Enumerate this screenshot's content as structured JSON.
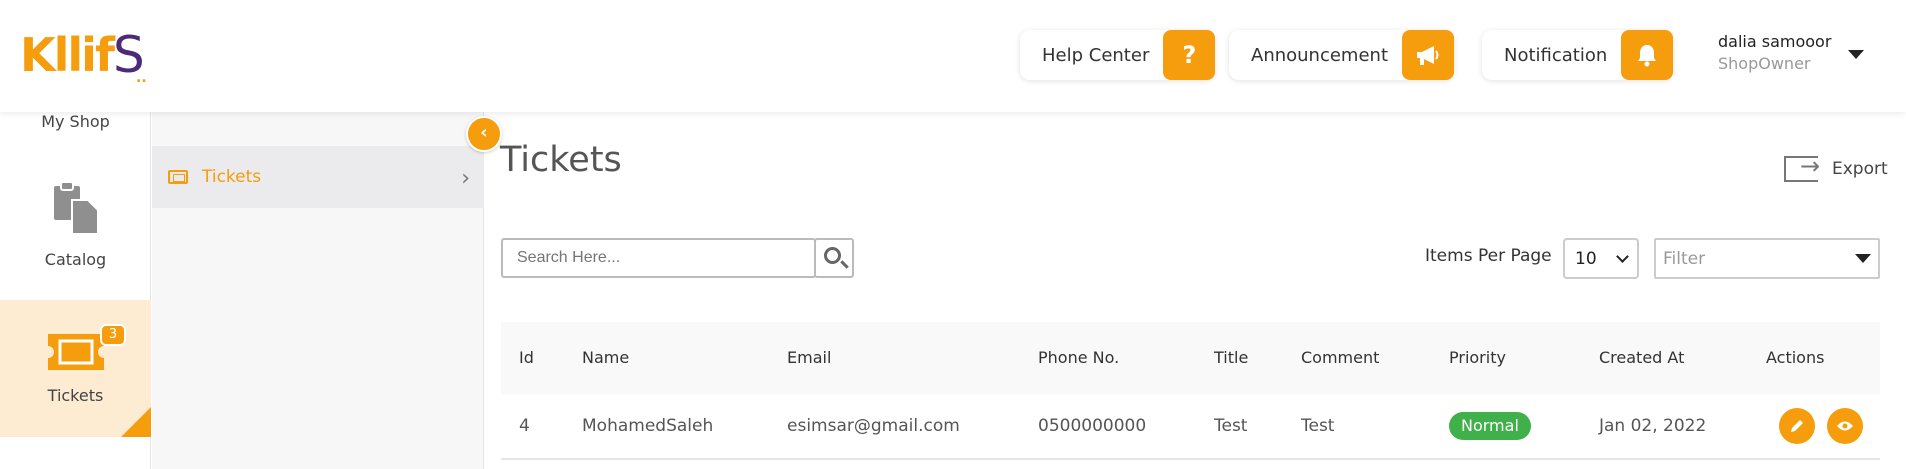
{
  "header": {
    "logo": "Kllif",
    "logo_s": "S",
    "logo_dots": "..",
    "help_label": "Help Center",
    "help_icon_glyph": "?",
    "announcement_label": "Announcement",
    "notification_label": "Notification",
    "user_name": "dalia samooor",
    "user_role": "ShopOwner"
  },
  "leftnav": {
    "my_shop": "My Shop",
    "catalog": "Catalog",
    "tickets": "Tickets",
    "tickets_badge": "3"
  },
  "subnav": {
    "items": [
      {
        "label": "Tickets"
      }
    ],
    "arrow_glyph": "›",
    "collapse_glyph": "‹"
  },
  "main": {
    "title": "Tickets",
    "export_label": "Export",
    "search_placeholder": "Search Here...",
    "items_per_page_label": "Items Per Page",
    "items_per_page_value": "10",
    "filter_placeholder": "Filter"
  },
  "table": {
    "columns": [
      "Id",
      "Name",
      "Email",
      "Phone No.",
      "Title",
      "Comment",
      "Priority",
      "Created At",
      "Actions"
    ],
    "rows": [
      {
        "id": "4",
        "name": "MohamedSaleh",
        "email": "esimsar@gmail.com",
        "phone": "0500000000",
        "title": "Test",
        "comment": "Test",
        "priority": "Normal",
        "created_at": "Jan 02, 2022"
      }
    ]
  },
  "colors": {
    "accent": "#f59d0c",
    "brand_purple": "#4b2a78",
    "priority_normal": "#3fb04a",
    "active_nav_bg": "#fdebd2"
  },
  "icons": {
    "help": "question-mark-icon",
    "announcement": "megaphone-icon",
    "notification": "bell-icon",
    "user_menu": "caret-down-icon",
    "catalog": "clipboard-copy-icon",
    "tickets": "ticket-icon",
    "export": "export-icon",
    "search": "search-icon",
    "edit": "pencil-icon",
    "view": "eye-icon"
  }
}
